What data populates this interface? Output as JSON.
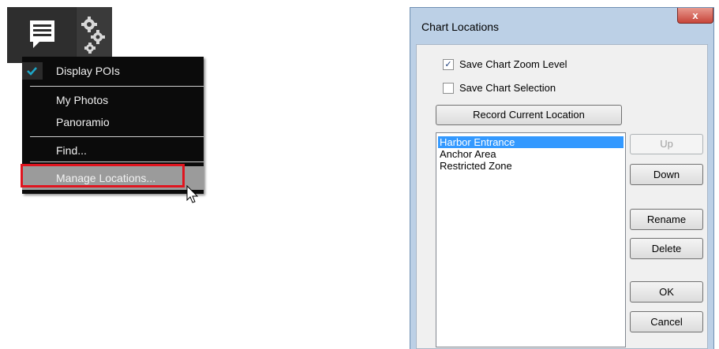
{
  "menu": {
    "items": [
      {
        "label": "Display POIs",
        "checked": true
      },
      {
        "label": "My Photos"
      },
      {
        "label": "Panoramio"
      },
      {
        "label": "Find..."
      },
      {
        "label": "Manage Locations...",
        "highlighted": true
      }
    ]
  },
  "dialog": {
    "title": "Chart Locations",
    "close_label": "x",
    "save_zoom_label": "Save Chart Zoom Level",
    "save_zoom_checked": true,
    "save_selection_label": "Save Chart Selection",
    "save_selection_checked": false,
    "record_button": "Record Current Location",
    "locations": [
      "Harbor Entrance",
      "Anchor Area",
      "Restricted Zone"
    ],
    "selected_location": "Harbor Entrance",
    "buttons": {
      "up": "Up",
      "down": "Down",
      "rename": "Rename",
      "delete": "Delete",
      "ok": "OK",
      "cancel": "Cancel"
    }
  },
  "colors": {
    "highlight_box": "#e0141e",
    "selection": "#3399ff",
    "menu_bg": "#0b0b0b",
    "check_color": "#1ea7c8"
  }
}
